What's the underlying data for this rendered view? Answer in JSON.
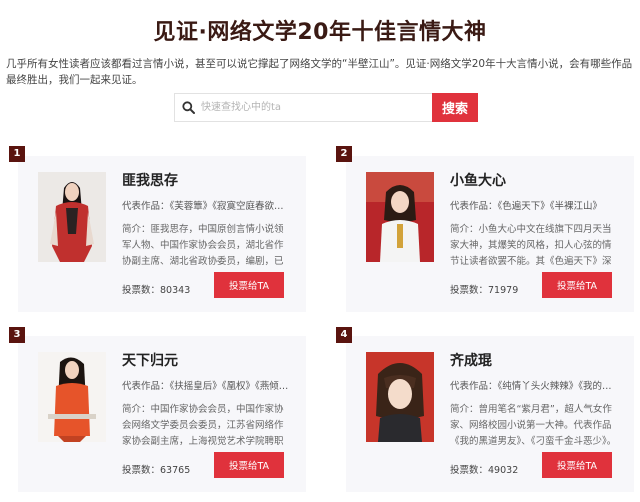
{
  "page": {
    "title": "见证·网络文学20年十佳言情大神",
    "intro": "几乎所有女性读者应该都看过言情小说，甚至可以说它撑起了网络文学的“半壁江山”。见证·网络文学20年十大言情小说，会有哪些作品最终胜出，我们一起来见证。"
  },
  "search": {
    "placeholder": "快速查找心中的ta",
    "button_label": "搜索",
    "icon": "search-icon"
  },
  "colors": {
    "accent": "#e0323c",
    "badge": "#5a140f",
    "card_bg": "#f7f7fa"
  },
  "authors": [
    {
      "rank": "1",
      "name": "匪我思存",
      "works": "代表作品：《芙蓉簟》《寂寞空庭春欲晚》",
      "bio": "简介：匪我思存，中国原创言情小说领军人物、中国作家协会会员，湖北省作协副主席、湖北省政协委员，编剧，已出版多部作品。",
      "votes_label": "投票数：",
      "votes": "80343",
      "vote_button": "投票给TA"
    },
    {
      "rank": "2",
      "name": "小鱼大心",
      "works": "代表作品：《色遍天下》《半裸江山》",
      "bio": "简介：小鱼大心中文在线旗下四月天当家大神，其爆笑的风格，扣人心弦的情节让读者欲罢不能。其《色遍天下》深受读者喜爱。",
      "votes_label": "投票数：",
      "votes": "71979",
      "vote_button": "投票给TA"
    },
    {
      "rank": "3",
      "name": "天下归元",
      "works": "代表作品：《扶摇皇后》《凰权》《燕倾天下》",
      "bio": "简介：中国作家协会会员，中国作家协会网络文学委员会委员，江苏省网络作家协会副主席，上海视觉艺术学院聘职教授。",
      "votes_label": "投票数：",
      "votes": "63765",
      "vote_button": "投票给TA"
    },
    {
      "rank": "4",
      "name": "齐成琨",
      "works": "代表作品：《纯情丫头火辣辣》《我的黑道男友》",
      "bio": "简介：曾用笔名“紫月君”，超人气女作家、网络校园小说第一大神。代表作品《我的黑道男友》、《刁蛮千金斗恶少》。",
      "votes_label": "投票数：",
      "votes": "49032",
      "vote_button": "投票给TA"
    }
  ]
}
